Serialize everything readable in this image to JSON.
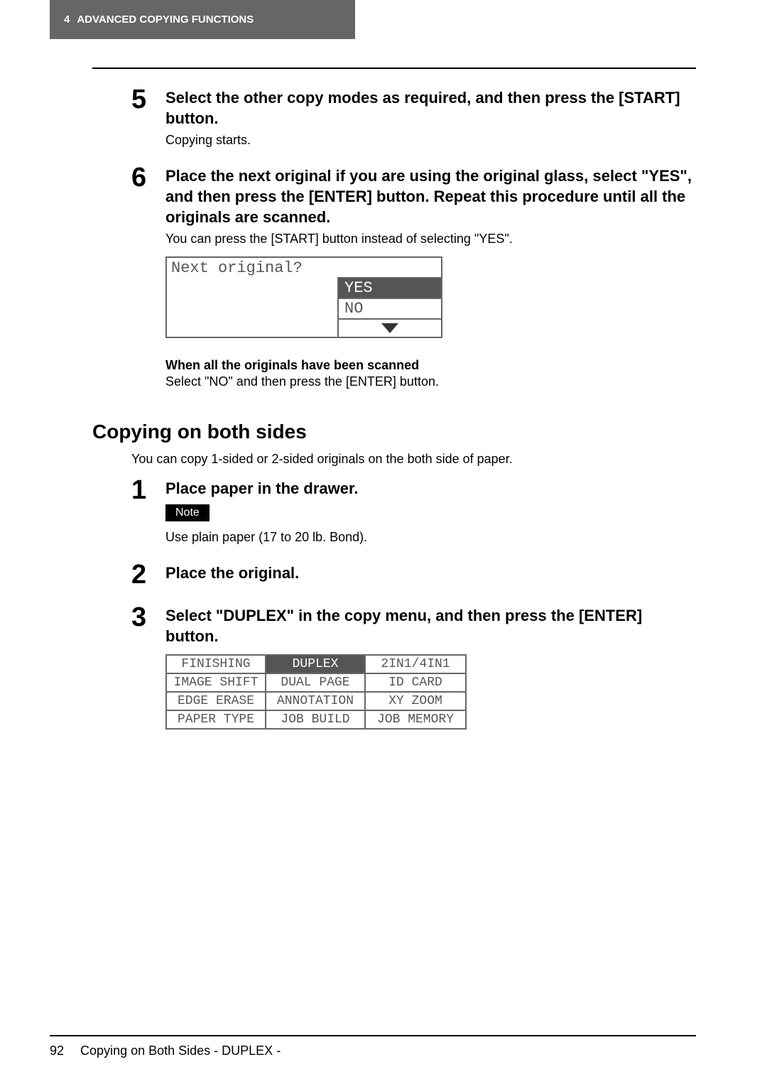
{
  "header": {
    "chapter_num": "4",
    "chapter_title": "ADVANCED COPYING FUNCTIONS"
  },
  "steps_top": [
    {
      "num": "5",
      "title": "Select the other copy modes as required, and then press the [START] button.",
      "text": "Copying starts."
    },
    {
      "num": "6",
      "title": "Place the next original if you are using the original glass, select \"YES\", and then press the [ENTER] button. Repeat this procedure until all the originals are scanned.",
      "text": "You can press the [START] button instead of selecting \"YES\"."
    }
  ],
  "lcd1": {
    "prompt": "Next original?",
    "opt_yes": "YES",
    "opt_no": "NO"
  },
  "scanned": {
    "heading": "When all the originals have been scanned",
    "text": "Select \"NO\" and then press the [ENTER] button."
  },
  "section": {
    "title": "Copying on both sides",
    "intro": "You can copy 1-sided or 2-sided originals on the both side of paper."
  },
  "steps_bottom": [
    {
      "num": "1",
      "title": "Place paper in the drawer.",
      "note_label": "Note",
      "note_text": "Use plain paper (17 to 20 lb. Bond)."
    },
    {
      "num": "2",
      "title": "Place the original."
    },
    {
      "num": "3",
      "title": "Select \"DUPLEX\" in the copy menu, and then press the [ENTER] button."
    }
  ],
  "menu": {
    "cells": [
      [
        "FINISHING",
        "DUPLEX",
        "2IN1/4IN1"
      ],
      [
        "IMAGE SHIFT",
        "DUAL PAGE",
        "ID CARD"
      ],
      [
        "EDGE ERASE",
        "ANNOTATION",
        "XY ZOOM"
      ],
      [
        "PAPER TYPE",
        "JOB BUILD",
        "JOB MEMORY"
      ]
    ],
    "selected": "DUPLEX"
  },
  "footer": {
    "page": "92",
    "text": "Copying on Both Sides - DUPLEX -"
  }
}
